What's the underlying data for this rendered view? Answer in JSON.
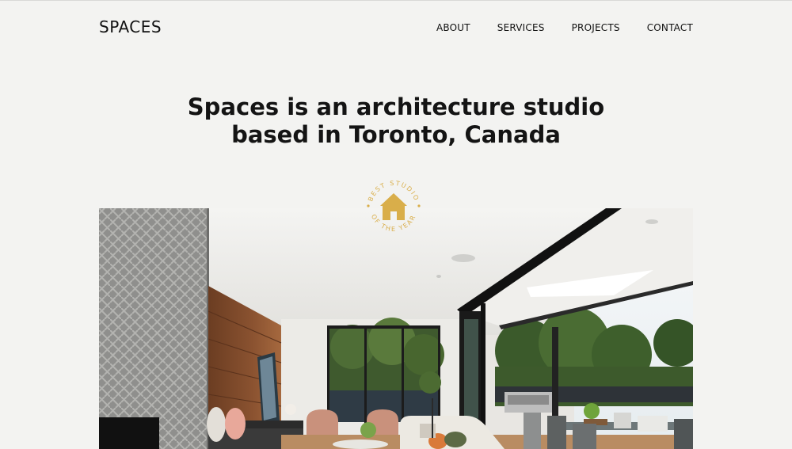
{
  "header": {
    "logo": "SPACES",
    "nav": [
      {
        "label": "ABOUT"
      },
      {
        "label": "SERVICES"
      },
      {
        "label": "PROJECTS"
      },
      {
        "label": "CONTACT"
      }
    ]
  },
  "hero": {
    "headline_line1": "Spaces is an architecture studio",
    "headline_line2": "based in Toronto, Canada"
  },
  "badge": {
    "top_text": "BEST STUDIO",
    "bottom_text": "OF THE YEAR",
    "icon": "house-icon",
    "color": "#d9ae4a"
  },
  "colors": {
    "background": "#f3f3f1",
    "text": "#111111",
    "accent": "#d9ae4a"
  }
}
